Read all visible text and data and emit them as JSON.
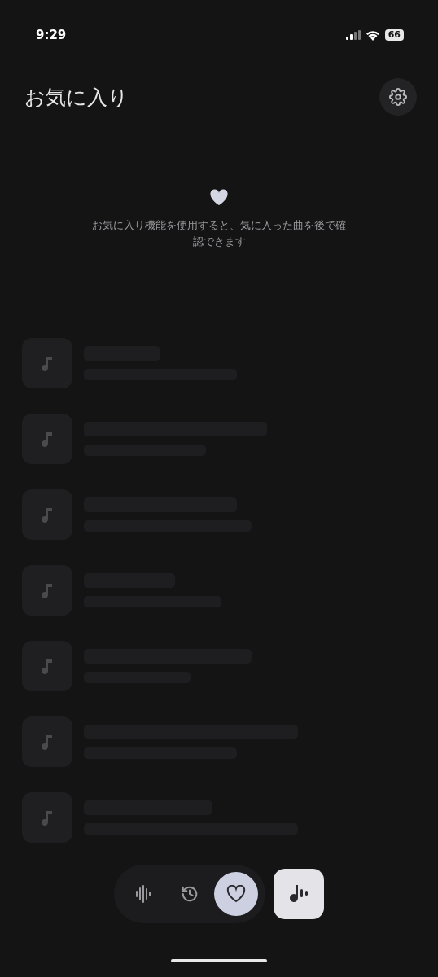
{
  "status_bar": {
    "time": "9:29",
    "battery": "66"
  },
  "header": {
    "title": "お気に入り"
  },
  "empty_state": {
    "message": "お気に入り機能を使用すると、気に入った曲を後で確認できます"
  },
  "placeholder_rows": [
    {
      "kind": "skeleton"
    },
    {
      "kind": "skeleton"
    },
    {
      "kind": "skeleton"
    },
    {
      "kind": "skeleton"
    },
    {
      "kind": "skeleton"
    },
    {
      "kind": "skeleton"
    },
    {
      "kind": "skeleton"
    }
  ],
  "nav_tabs": [
    {
      "kind": "waveform",
      "selected": false
    },
    {
      "kind": "history",
      "selected": false
    },
    {
      "kind": "heart",
      "selected": true
    }
  ]
}
